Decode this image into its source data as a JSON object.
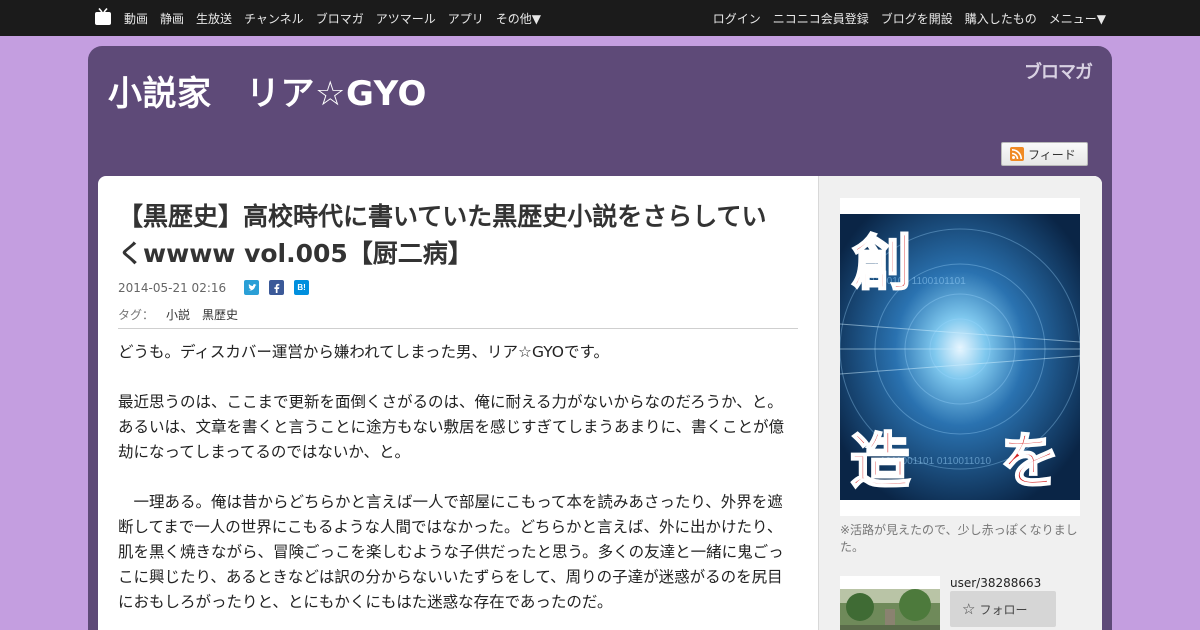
{
  "topnav": {
    "logo_icon": "tv-icon",
    "left_items": [
      "動画",
      "静画",
      "生放送",
      "チャンネル",
      "ブロマガ",
      "アツマール",
      "アプリ",
      "その他▼"
    ],
    "login": "ログイン",
    "register": "ニコニコ会員登録",
    "open_blog": "ブログを開設",
    "purchased": "購入したもの",
    "menu": "メニュー▼"
  },
  "blog": {
    "title": "小説家　リア☆GYO",
    "brand": "ブロマガ",
    "feed_label": "フィード",
    "feed_icon": "rss-icon"
  },
  "article": {
    "title": "【黒歴史】高校時代に書いていた黒歴史小説をさらしていくwwww vol.005【厨二病】",
    "date": "2014-05-21 02:16",
    "share": {
      "twitter": "twitter-icon",
      "facebook": "facebook-icon",
      "hatena": "hatena-bookmark-icon",
      "hatena_text": "B!"
    },
    "tag_label": "タグ：",
    "tags": [
      "小説",
      "黒歴史"
    ],
    "paragraphs": [
      "どうも。ディスカバー運営から嫌われてしまった男、リア☆GYOです。",
      "最近思うのは、ここまで更新を面倒くさがるのは、俺に耐える力がないからなのだろうか、と。あるいは、文章を書くと言うことに途方もない敷居を感じすぎてしまうあまりに、書くことが億劫になってしまってるのではないか、と。",
      "一理ある。俺は昔からどちらかと言えば一人で部屋にこもって本を読みあさったり、外界を遮断してまで一人の世界にこもるような人間ではなかった。どちらかと言えば、外に出かけたり、肌を黒く焼きながら、冒険ごっこを楽しむような子供だったと思う。多くの友達と一緒に鬼ごっこに興じたり、あるときなどは訳の分からないいたずらをして、周りの子達が迷惑がるのを尻目におもしろがったりと、とにもかくにもはた迷惑な存在であったのだ。"
    ]
  },
  "sidebar": {
    "image_text": [
      "創",
      "造",
      "を"
    ],
    "caption": "※活路が見えたので、少し赤っぽくなりました。",
    "user_name": "user/38288663",
    "follow_label": "フォロー",
    "follow_icon": "star-icon"
  },
  "colors": {
    "page_bg": "#c49ee0",
    "header_bg": "#5e4a78",
    "topnav_bg": "#1b1b1b",
    "login": "#66c8e6",
    "register": "#f0c040",
    "image_glyph": "#d42020"
  }
}
